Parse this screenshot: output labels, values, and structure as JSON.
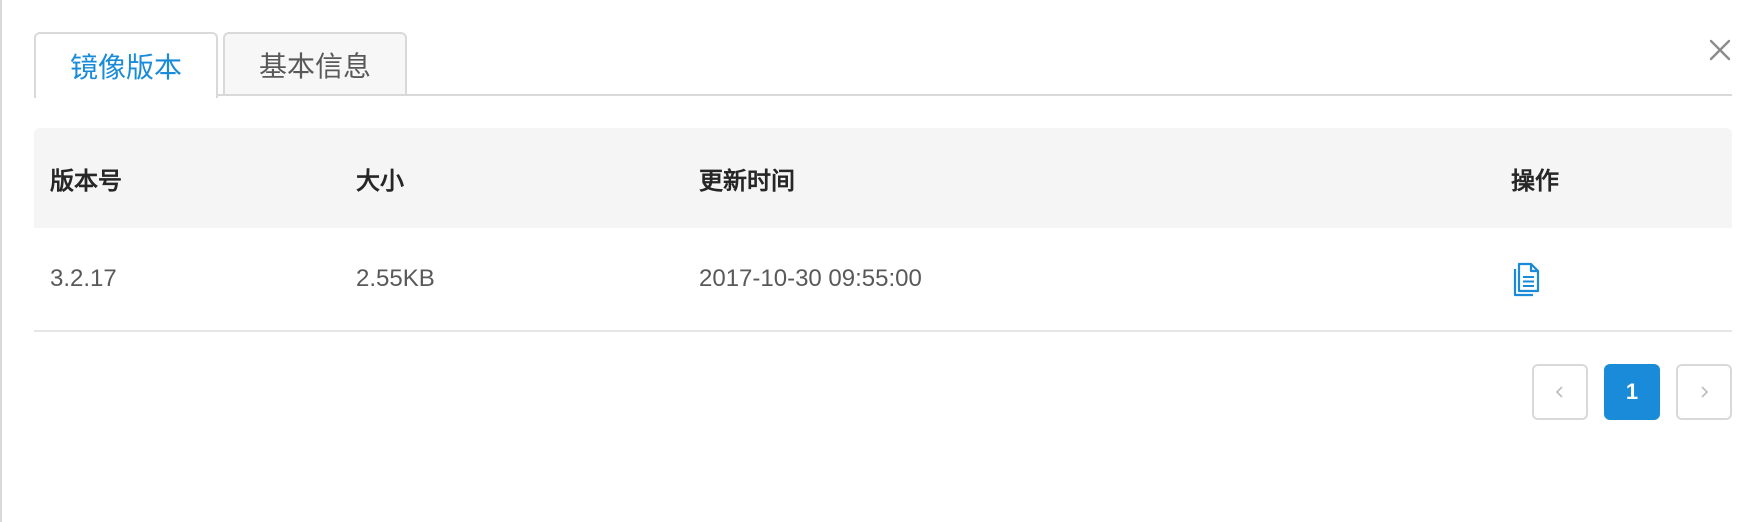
{
  "tabs": [
    {
      "label": "镜像版本",
      "active": true
    },
    {
      "label": "基本信息",
      "active": false
    }
  ],
  "close_icon": "close-icon",
  "table": {
    "headers": {
      "version": "版本号",
      "size": "大小",
      "updated": "更新时间",
      "actions": "操作"
    },
    "rows": [
      {
        "version": "3.2.17",
        "size": "2.55KB",
        "updated": "2017-10-30 09:55:00",
        "action_icon": "document-icon"
      }
    ]
  },
  "pagination": {
    "prev_icon": "chevron-left-icon",
    "current_page": "1",
    "next_icon": "chevron-right-icon"
  },
  "colors": {
    "accent": "#1a8bd8",
    "header_bg": "#f5f5f5",
    "border": "#d9d9d9"
  }
}
